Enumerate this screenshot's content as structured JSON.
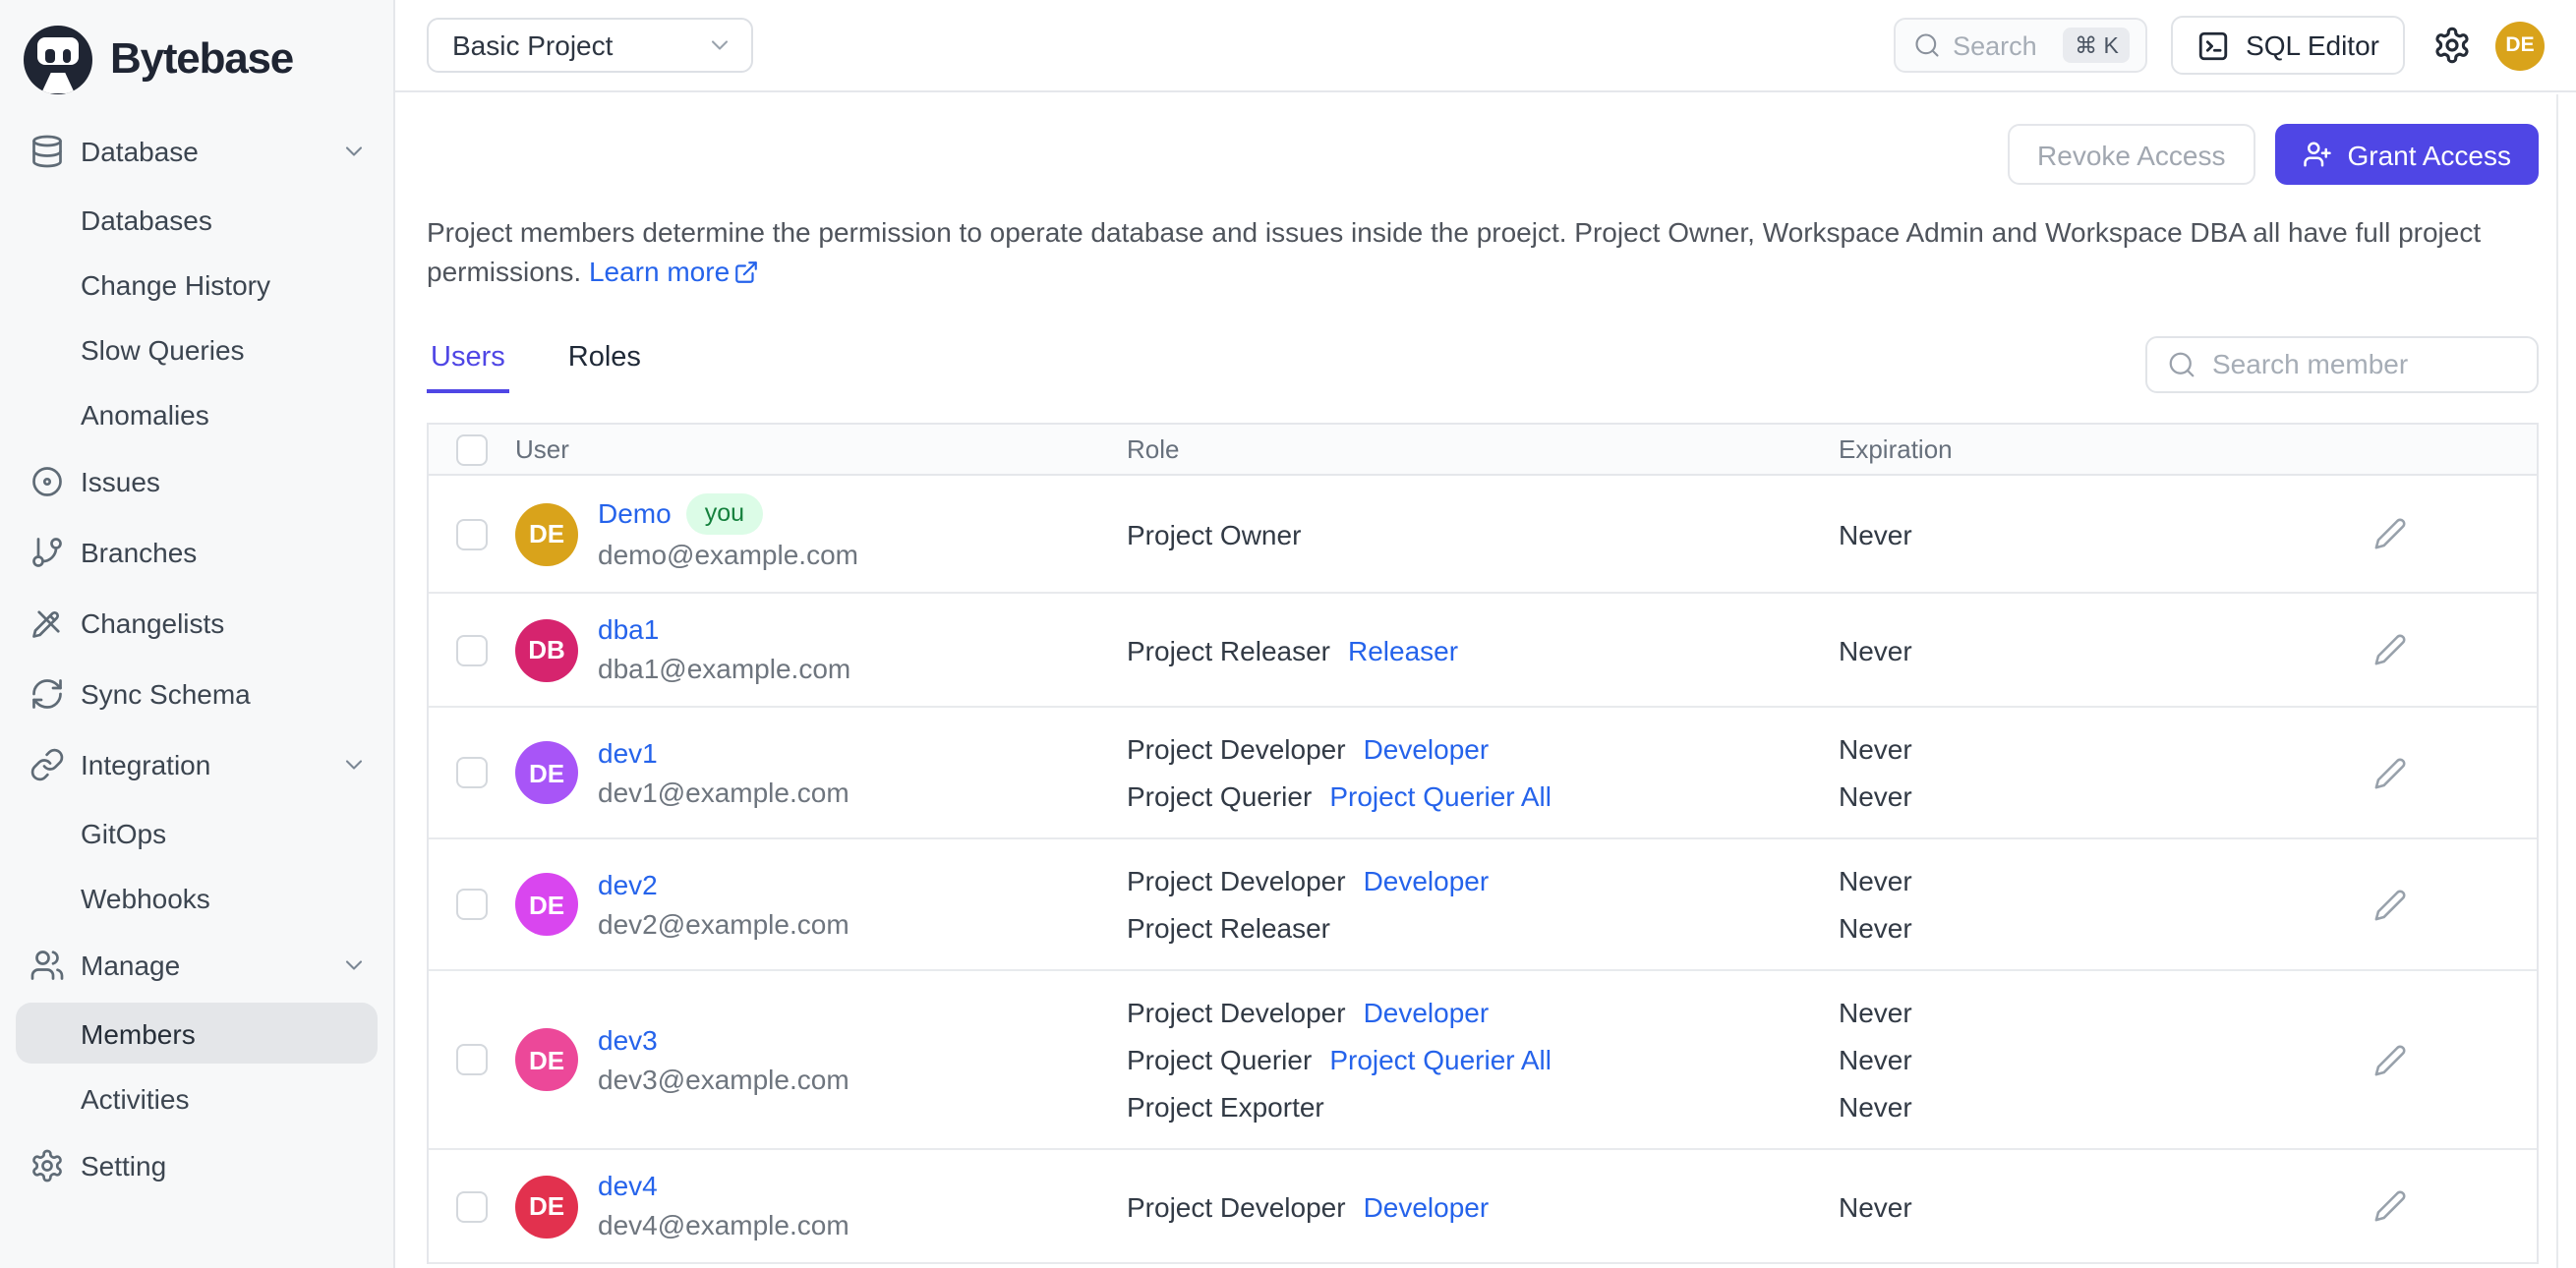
{
  "brand": {
    "name": "Bytebase"
  },
  "colors": {
    "accent": "#4f46e5",
    "link": "#2563eb",
    "brand_dark": "#1f2533",
    "you_badge_bg": "#dcfce7",
    "you_badge_text": "#15803d"
  },
  "topbar": {
    "project_selector": "Basic Project",
    "search_placeholder": "Search",
    "search_shortcut": "⌘ K",
    "sql_editor": "SQL Editor",
    "avatar_initials": "DE"
  },
  "sidebar": {
    "items": [
      {
        "label": "Database",
        "icon": "database",
        "expandable": true,
        "level": 0
      },
      {
        "label": "Databases",
        "level": 1
      },
      {
        "label": "Change History",
        "level": 1
      },
      {
        "label": "Slow Queries",
        "level": 1
      },
      {
        "label": "Anomalies",
        "level": 1
      },
      {
        "label": "Issues",
        "icon": "circle-dot",
        "level": 0
      },
      {
        "label": "Branches",
        "icon": "git-branch",
        "level": 0
      },
      {
        "label": "Changelists",
        "icon": "pencil-cross",
        "level": 0
      },
      {
        "label": "Sync Schema",
        "icon": "sync",
        "level": 0
      },
      {
        "label": "Integration",
        "icon": "link",
        "expandable": true,
        "level": 0
      },
      {
        "label": "GitOps",
        "level": 1
      },
      {
        "label": "Webhooks",
        "level": 1
      },
      {
        "label": "Manage",
        "icon": "users",
        "expandable": true,
        "level": 0
      },
      {
        "label": "Members",
        "level": 1,
        "selected": true
      },
      {
        "label": "Activities",
        "level": 1
      },
      {
        "label": "Setting",
        "icon": "gear",
        "level": 0
      }
    ]
  },
  "page": {
    "revoke_button": "Revoke Access",
    "grant_button": "Grant Access",
    "description": "Project members determine the permission to operate database and issues inside the proejct. Project Owner, Workspace Admin and Workspace DBA all have full project permissions.",
    "learn_more": "Learn more",
    "tabs": [
      {
        "label": "Users",
        "active": true
      },
      {
        "label": "Roles",
        "active": false
      }
    ],
    "member_search_placeholder": "Search member",
    "table": {
      "columns": [
        "User",
        "Role",
        "Expiration"
      ],
      "rows": [
        {
          "initials": "DE",
          "avatar_color": "#d9a31b",
          "name": "Demo",
          "you_badge": "you",
          "email": "demo@example.com",
          "roles": [
            {
              "role": "Project Owner",
              "binding": ""
            }
          ],
          "expirations": [
            "Never"
          ]
        },
        {
          "initials": "DB",
          "avatar_color": "#d6246e",
          "name": "dba1",
          "email": "dba1@example.com",
          "roles": [
            {
              "role": "Project Releaser",
              "binding": "Releaser"
            }
          ],
          "expirations": [
            "Never"
          ]
        },
        {
          "initials": "DE",
          "avatar_color": "#a855f7",
          "name": "dev1",
          "email": "dev1@example.com",
          "roles": [
            {
              "role": "Project Developer",
              "binding": "Developer"
            },
            {
              "role": "Project Querier",
              "binding": "Project Querier All"
            }
          ],
          "expirations": [
            "Never",
            "Never"
          ]
        },
        {
          "initials": "DE",
          "avatar_color": "#d946ef",
          "name": "dev2",
          "email": "dev2@example.com",
          "roles": [
            {
              "role": "Project Developer",
              "binding": "Developer"
            },
            {
              "role": "Project Releaser",
              "binding": ""
            }
          ],
          "expirations": [
            "Never",
            "Never"
          ]
        },
        {
          "initials": "DE",
          "avatar_color": "#ec4899",
          "name": "dev3",
          "email": "dev3@example.com",
          "roles": [
            {
              "role": "Project Developer",
              "binding": "Developer"
            },
            {
              "role": "Project Querier",
              "binding": "Project Querier All"
            },
            {
              "role": "Project Exporter",
              "binding": ""
            }
          ],
          "expirations": [
            "Never",
            "Never",
            "Never"
          ]
        },
        {
          "initials": "DE",
          "avatar_color": "#e2314e",
          "name": "dev4",
          "email": "dev4@example.com",
          "roles": [
            {
              "role": "Project Developer",
              "binding": "Developer"
            }
          ],
          "expirations": [
            "Never"
          ]
        }
      ]
    }
  }
}
